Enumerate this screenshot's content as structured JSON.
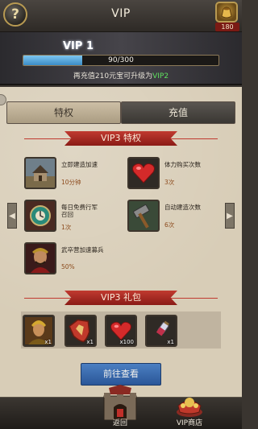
{
  "header": {
    "title": "VIP",
    "help_icon": "?",
    "gold_count": "180"
  },
  "vip": {
    "level_label": "VIP 1",
    "progress_text": "90/300",
    "progress_fraction": 0.3,
    "upgrade_hint_prefix": "再充值210元宝可升级为",
    "upgrade_hint_target": "VIP2"
  },
  "tabs": {
    "privilege": "特权",
    "recharge": "充值"
  },
  "privileges": {
    "banner": "VIP3 特权",
    "items": [
      {
        "icon": "building-speedup-icon",
        "label": "立即建造加速",
        "value": "10分钟"
      },
      {
        "icon": "heart-icon",
        "label": "体力购买次数",
        "value": "3次"
      },
      {
        "icon": "march-recall-icon",
        "label": "每日免费行军\n召回",
        "value": "1次"
      },
      {
        "icon": "hammer-icon",
        "label": "自动建造次数",
        "value": "6次"
      },
      {
        "icon": "general-portrait-icon",
        "label": "武卒营加速募兵",
        "value": "50%"
      }
    ]
  },
  "gift": {
    "banner": "VIP3 礼包",
    "items": [
      {
        "icon": "hero-portrait-icon",
        "qty": "x1"
      },
      {
        "icon": "shield-icon",
        "qty": "x1"
      },
      {
        "icon": "heart-icon",
        "qty": "x100"
      },
      {
        "icon": "potion-icon",
        "qty": "x1"
      }
    ]
  },
  "buttons": {
    "goto": "前往查看",
    "back": "返回",
    "vip_shop": "VIP商店"
  },
  "colors": {
    "accent_red": "#a82a22",
    "accent_blue": "#3b8cc6",
    "highlight_green": "#5fe05f"
  }
}
